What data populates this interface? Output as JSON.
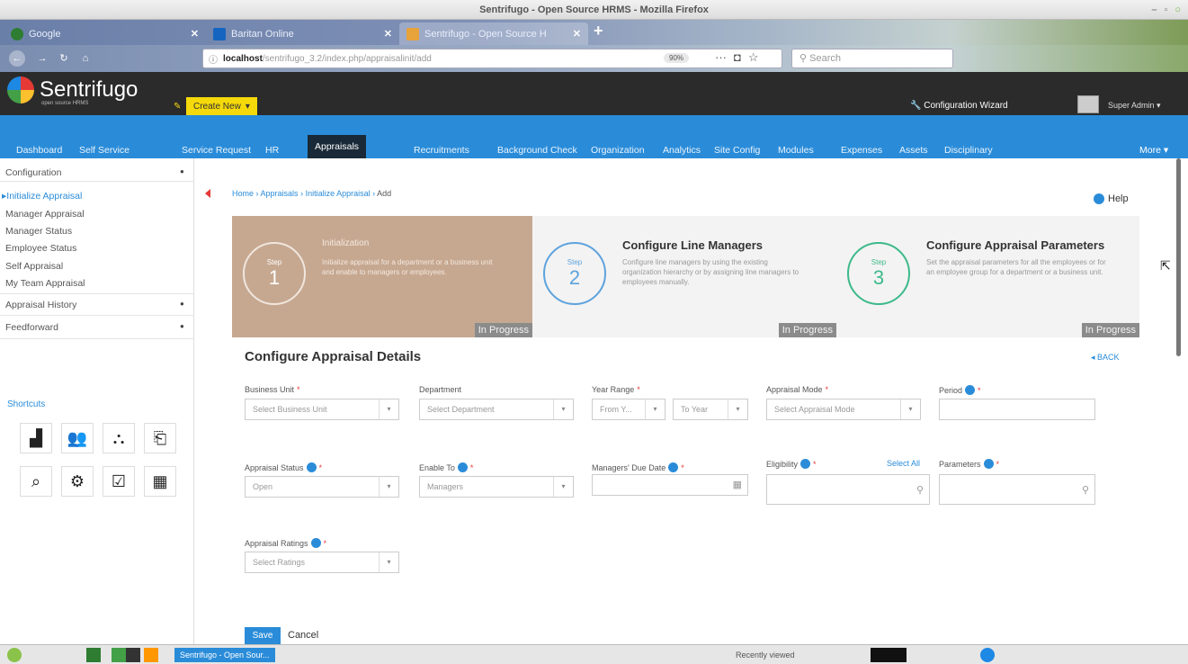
{
  "window": {
    "title": "Sentrifugo - Open Source HRMS - Mozilla Firefox"
  },
  "browser": {
    "tabs": [
      {
        "label": "Google",
        "favicon_color": "#2e7d32"
      },
      {
        "label": "Baritan Online",
        "favicon_color": "#1565c0"
      },
      {
        "label": "Sentrifugo - Open Source H",
        "favicon_color": "#e8a23a"
      }
    ],
    "url_host": "localhost",
    "url_path": "/sentrifugo_3.2/index.php/appraisalinit/add",
    "zoom": "90%",
    "search_placeholder": "Search"
  },
  "app": {
    "logo_text": "Sentrifugo",
    "logo_sub": "open source HRMS",
    "create_new": "Create New",
    "config_wizard": "Configuration Wizard",
    "user_name": "Super Admin"
  },
  "menu": {
    "items": [
      "Dashboard",
      "Self Service",
      "Service Request",
      "HR",
      "Appraisals",
      "Recruitments",
      "Background Check",
      "Organization",
      "Analytics",
      "Site Config",
      "Modules",
      "Expenses",
      "Assets",
      "Disciplinary"
    ],
    "more": "More",
    "active_index": 4,
    "color": "#2a8cd9"
  },
  "sidebar": {
    "configuration": "Configuration",
    "items": [
      "Initialize Appraisal",
      "Manager Appraisal",
      "Manager Status",
      "Employee Status",
      "Self Appraisal",
      "My Team Appraisal"
    ],
    "appraisal_history": "Appraisal History",
    "feedforward": "Feedforward",
    "shortcuts": "Shortcuts",
    "shortcut_icons": [
      "chart-icon",
      "team-icon",
      "org-icon",
      "exit-icon",
      "chat-icon",
      "gear-icon",
      "edit-icon",
      "grid-icon"
    ]
  },
  "breadcrumb": [
    "Home",
    "Appraisals",
    "Initialize Appraisal",
    "Add"
  ],
  "help": "Help",
  "steps": [
    {
      "word": "Step",
      "number": "1",
      "title": "Initialization",
      "desc": "Initialize appraisal for a department or a business unit and enable to managers or employees.",
      "status": "In Progress"
    },
    {
      "word": "Step",
      "number": "2",
      "title": "Configure Line Managers",
      "desc": "Configure line managers by using the existing organization hierarchy or by assigning line managers to employees manually.",
      "status": "In Progress"
    },
    {
      "word": "Step",
      "number": "3",
      "title": "Configure Appraisal Parameters",
      "desc": "Set the appraisal parameters for all the employees or for an employee group for a department or a business unit.",
      "status": "In Progress"
    }
  ],
  "form": {
    "title": "Configure Appraisal Details",
    "back": "BACK",
    "business_unit": {
      "label": "Business Unit",
      "value": "Select Business Unit"
    },
    "department": {
      "label": "Department",
      "value": "Select Department"
    },
    "year_range": {
      "label": "Year Range",
      "from": "From Y...",
      "to": "To Year"
    },
    "appraisal_mode": {
      "label": "Appraisal Mode",
      "value": "Select Appraisal Mode"
    },
    "period": {
      "label": "Period"
    },
    "appraisal_status": {
      "label": "Appraisal Status",
      "value": "Open"
    },
    "enable_to": {
      "label": "Enable To",
      "value": "Managers"
    },
    "managers_due_date": {
      "label": "Managers' Due Date"
    },
    "eligibility": {
      "label": "Eligibility",
      "select_all": "Select All"
    },
    "parameters": {
      "label": "Parameters"
    },
    "appraisal_ratings": {
      "label": "Appraisal Ratings",
      "value": "Select Ratings"
    },
    "save": "Save",
    "cancel": "Cancel"
  },
  "taskbar": {
    "active_window": "Sentrifugo - Open Sour...",
    "recently_viewed": "Recently viewed"
  }
}
